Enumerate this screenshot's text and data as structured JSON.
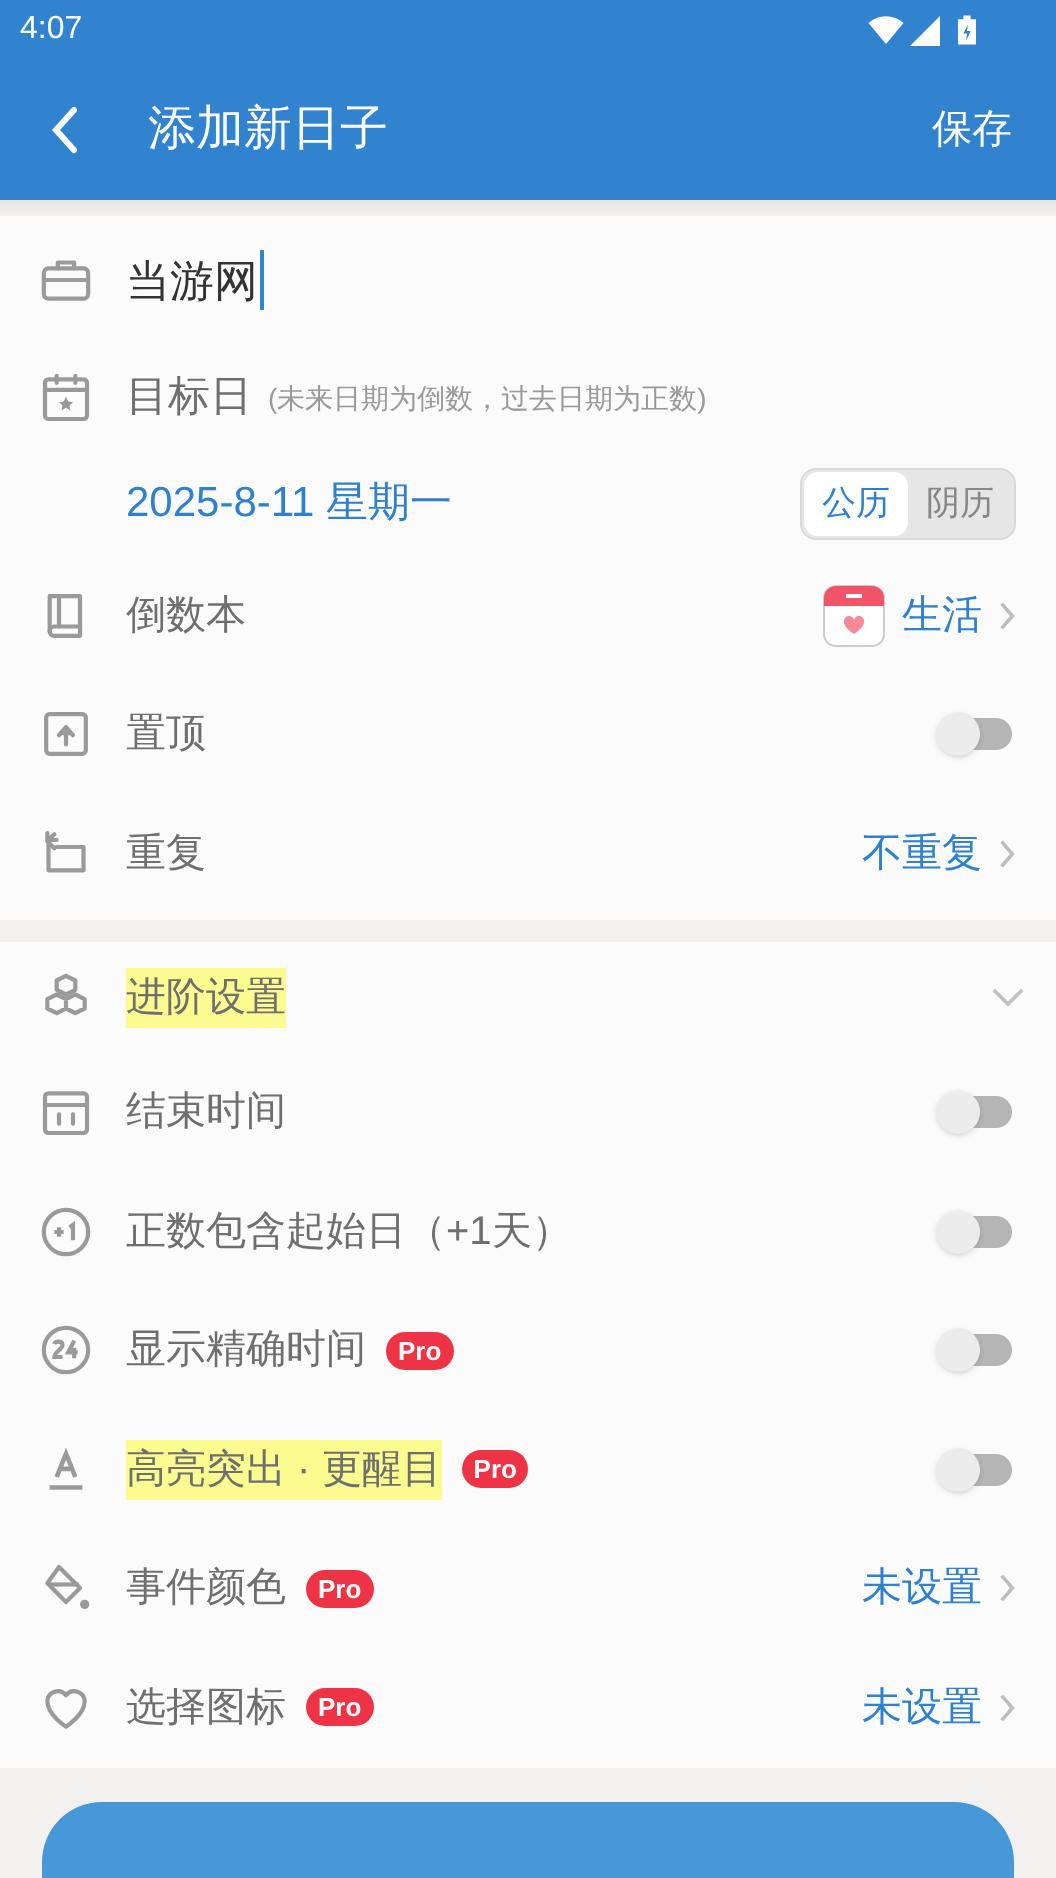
{
  "status_bar": {
    "time": "4:07"
  },
  "header": {
    "title": "添加新日子",
    "action": "保存"
  },
  "name_field": {
    "value": "当游网"
  },
  "target_date": {
    "label": "目标日",
    "hint": "(未来日期为倒数，过去日期为正数)",
    "date": "2025-8-11 星期一",
    "calendars": [
      {
        "label": "公历",
        "selected": true
      },
      {
        "label": "阴历",
        "selected": false
      }
    ]
  },
  "basic_rows": [
    {
      "kind": "link",
      "label": "倒数本",
      "value": "生活",
      "book_icon": true
    },
    {
      "kind": "toggle",
      "label": "置顶",
      "on": false
    },
    {
      "kind": "link",
      "label": "重复",
      "value": "不重复"
    }
  ],
  "advanced": {
    "title": "进阶设置",
    "expanded": true,
    "rows": [
      {
        "kind": "toggle",
        "label": "结束时间",
        "on": false
      },
      {
        "kind": "toggle",
        "label": "正数包含起始日（+1天）",
        "on": false
      },
      {
        "kind": "toggle",
        "label": "显示精确时间",
        "badge": "Pro",
        "on": false
      },
      {
        "kind": "toggle",
        "label": "高亮突出 · 更醒目",
        "badge": "Pro",
        "highlighted": true,
        "on": false
      },
      {
        "kind": "link",
        "label": "事件颜色",
        "badge": "Pro",
        "value": "未设置"
      },
      {
        "kind": "link",
        "label": "选择图标",
        "badge": "Pro",
        "value": "未设置"
      }
    ]
  },
  "bottom_button": {
    "kind": "button"
  }
}
